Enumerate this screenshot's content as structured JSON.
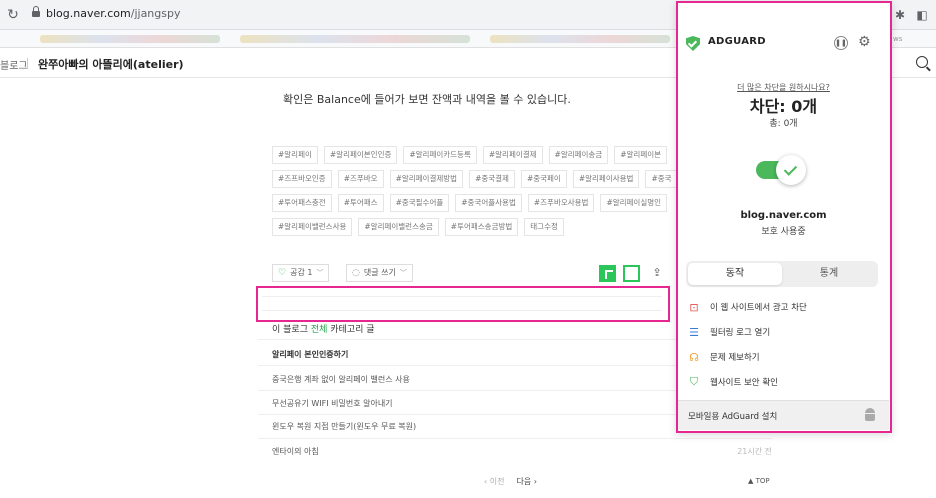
{
  "browser": {
    "url_domain": "blog.naver.com",
    "url_path": "/jjangspy",
    "reload_icon": "↻",
    "extensions": [
      "share-icon",
      "star-icon",
      "translate-icon",
      "adguard-icon",
      "puzzle-icon",
      "sidepanel-icon"
    ],
    "peek_text": "ws"
  },
  "blog": {
    "nav_label": "블로그",
    "title": "완쭈아빠의 아뜰리에(atelier)",
    "post_text": "확인은 Balance에 들어가 보면 잔액과 내역을 볼 수 있습니다.",
    "tags": [
      "#알리페이",
      "#알리페이본인인증",
      "#알리페이카드등록",
      "#알리페이결제",
      "#알리페이송금",
      "#알리페이본",
      "#즈프바오인증",
      "#즈푸바오",
      "#알리페이결제방법",
      "#중국결제",
      "#중국페이",
      "#알리페이사용법",
      "#중국",
      "#투어패스충전",
      "#투어패스",
      "#중국필수어플",
      "#중국어플사용법",
      "#즈푸바오사용법",
      "#알리페이실명인",
      "#알리페이밸런스사용",
      "#알리페이밸런스송금",
      "#투어패스송금방법",
      "태그수정"
    ],
    "actions": {
      "like_label": "공감 1",
      "comment_label": "댓글 쓰기"
    },
    "related": {
      "head_prefix": "이 블로그 ",
      "head_highlight": "전체",
      "head_suffix": " 카테고리 글",
      "items": [
        {
          "title": "알리페이 본인인증하기",
          "time": ""
        },
        {
          "title": "중국은행 계좌 없이 알리페이 밸런스 사용",
          "time": ""
        },
        {
          "title": "무선공유기 WIFI 비밀번호 알아내기",
          "time": ""
        },
        {
          "title": "윈도우 복원 지점 만들기(윈도우 무료 복원)",
          "time": ""
        },
        {
          "title": "엔타이의 아침",
          "time": "21시간 전"
        }
      ]
    },
    "pager": {
      "prev": "‹ 이전",
      "next": "다음 ›"
    },
    "top_link": "▲ TOP"
  },
  "adguard": {
    "brand": "ADGUARD",
    "more_link": "더 많은 차단을 원하시나요?",
    "blocked": "차단: 0개",
    "total": "총: 0개",
    "domain": "blog.naver.com",
    "status": "보호 사용중",
    "tabs": {
      "actions": "동작",
      "stats": "통계"
    },
    "menu": [
      {
        "label": "이 웹 사이트에서 광고 차단",
        "icon": "block-ad-icon"
      },
      {
        "label": "필터링 로그 열기",
        "icon": "log-icon"
      },
      {
        "label": "문제 제보하기",
        "icon": "report-icon"
      },
      {
        "label": "웹사이트 보안 확인",
        "icon": "shield-check-icon"
      }
    ],
    "footer": "모바일용 AdGuard 설치",
    "colors": {
      "accent": "#4cb85c",
      "highlight": "#e62791"
    }
  }
}
